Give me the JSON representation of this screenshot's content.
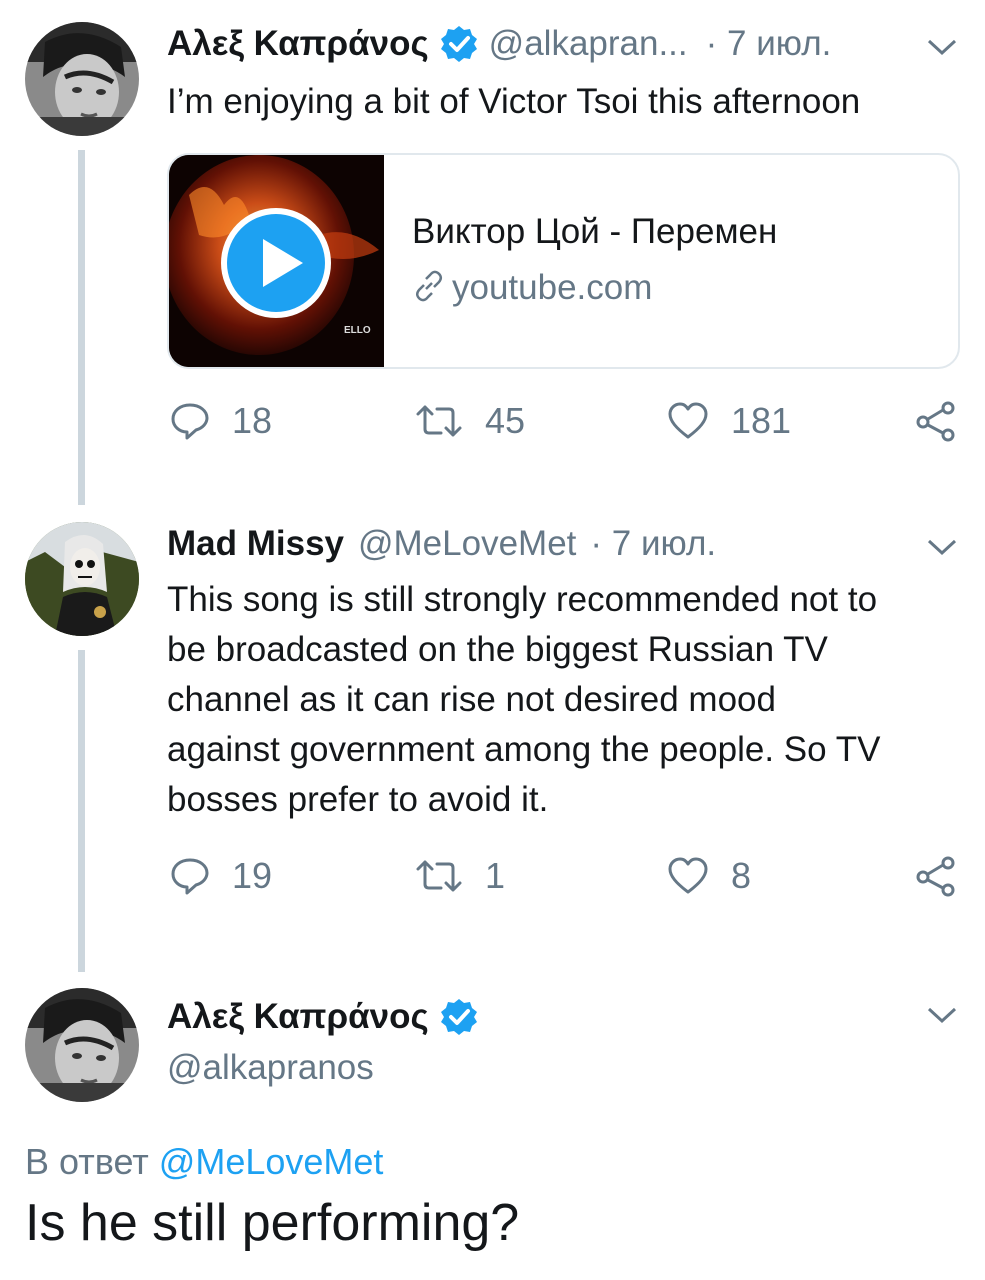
{
  "tweet1": {
    "name": "Αλεξ Καπράνος",
    "handle": "@alkapran...",
    "time": "· 7 июл.",
    "text": "I’m enjoying a bit of Victor Tsoi this afternoon",
    "card": {
      "title": "Виктор Цой - Перемен",
      "link": "youtube.com",
      "thumb_caption": "ELLO"
    },
    "replies": "18",
    "retweets": "45",
    "likes": "181"
  },
  "tweet2": {
    "name": "Mad Missy",
    "handle": "@MeLoveMet",
    "time": "· 7 июл.",
    "text_lines": [
      "This song is still strongly recommended not to",
      "be broadcasted on the biggest Russian TV",
      "channel as it can rise not desired mood",
      "against government among the people. So TV",
      "bosses prefer to avoid it."
    ],
    "replies": "19",
    "retweets": "1",
    "likes": "8"
  },
  "tweet3": {
    "name": "Αλεξ Καπράνος",
    "handle": "@alkapranos",
    "reply_prefix": "В ответ",
    "reply_to": "@MeLoveMet",
    "text": "Is he still performing?"
  },
  "colors": {
    "verified": "#1da1f2",
    "secondary_text": "#657786",
    "thread_line": "#ccd6dd"
  },
  "icons": [
    "verified-badge-icon",
    "chevron-down-icon",
    "reply-icon",
    "retweet-icon",
    "like-icon",
    "share-icon",
    "link-icon",
    "play-icon"
  ]
}
